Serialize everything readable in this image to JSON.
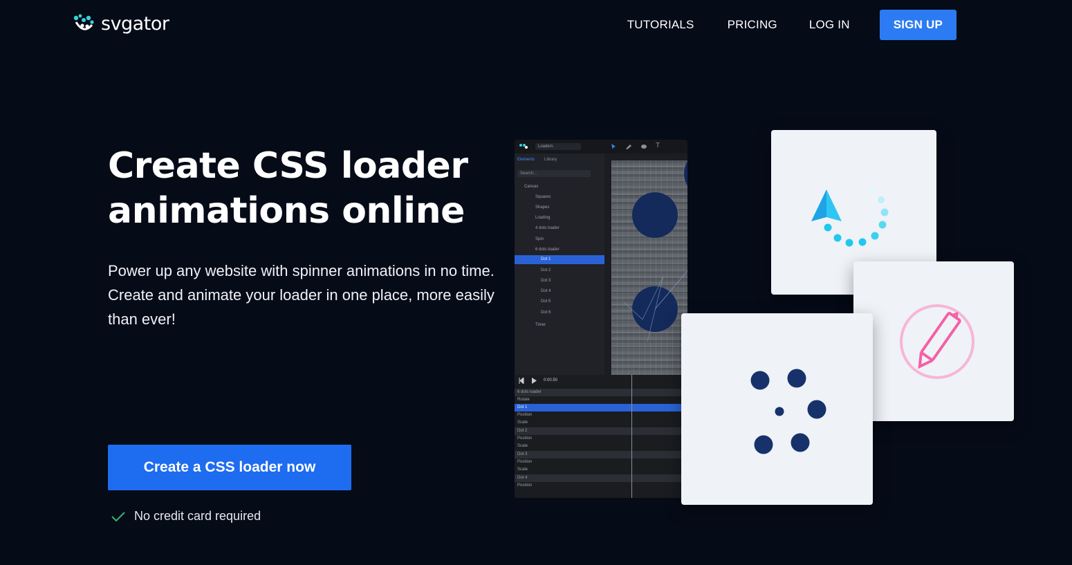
{
  "brand": {
    "name": "svgator"
  },
  "nav": {
    "tutorials": "TUTORIALS",
    "pricing": "PRICING",
    "login": "LOG IN",
    "signup": "SIGN UP"
  },
  "hero": {
    "title_line1": "Create CSS loader",
    "title_line2": "animations online",
    "subtitle": "Power up any website with spinner animations in no time. Create and animate your loader in one place, more easily than ever!",
    "cta": "Create a CSS loader now",
    "note": "No credit card required"
  },
  "editor": {
    "project": "Loaders",
    "tab_elements": "Elements",
    "tab_library": "Library",
    "search_placeholder": "Search...",
    "root": "Canvas",
    "layers": [
      "Squares",
      "Shapes",
      "Loading",
      "4 dots loader",
      "Spin",
      "6 dots loader"
    ],
    "dots": [
      "Dot 1",
      "Dot 2",
      "Dot 3",
      "Dot 4",
      "Dot 5",
      "Dot 6"
    ],
    "timer_layer": "Timer",
    "time": "0:00.50",
    "timeline_group": "6 dots loader",
    "rotate": "Rotate",
    "tl_dot1": "Dot 1",
    "tl_dot2": "Dot 2",
    "tl_dot3": "Dot 3",
    "tl_dot4": "Dot 4",
    "position": "Position",
    "scale": "Scale"
  },
  "colors": {
    "background": "#060b18",
    "primary": "#1e6cf0",
    "signup": "#2c7bf2",
    "accent_cyan": "#22c7ee",
    "accent_pink": "#f460a6",
    "dot_navy": "#17326a",
    "check_green": "#3db36b"
  }
}
